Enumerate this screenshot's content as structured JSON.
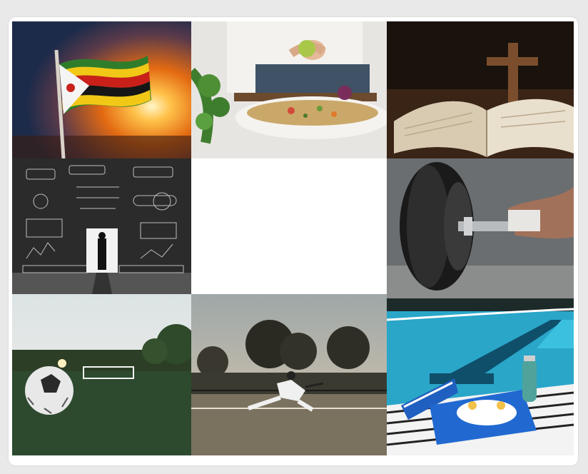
{
  "gallery": {
    "tiles": [
      {
        "subject": "zimbabwe-flag-at-sunset"
      },
      {
        "subject": "squeezing-lime-over-salad-bowl"
      },
      {
        "subject": "wooden-cross-on-open-bible"
      },
      {
        "subject": "man-in-doorway-chalkboard-doodles"
      },
      {
        "subject": "empty-white-tile"
      },
      {
        "subject": "hand-gripping-barbell"
      },
      {
        "subject": "soccer-ball-on-field"
      },
      {
        "subject": "tennis-player-at-dusk"
      },
      {
        "subject": "swimming-pool-with-kickboard-and-goggles"
      }
    ],
    "colors": {
      "background": "#e9e9e9",
      "frame": "#ffffff",
      "pool_water": "#2aa6c9",
      "sunset_orange": "#f08a1c",
      "chalkboard": "#2b2b2b"
    }
  }
}
